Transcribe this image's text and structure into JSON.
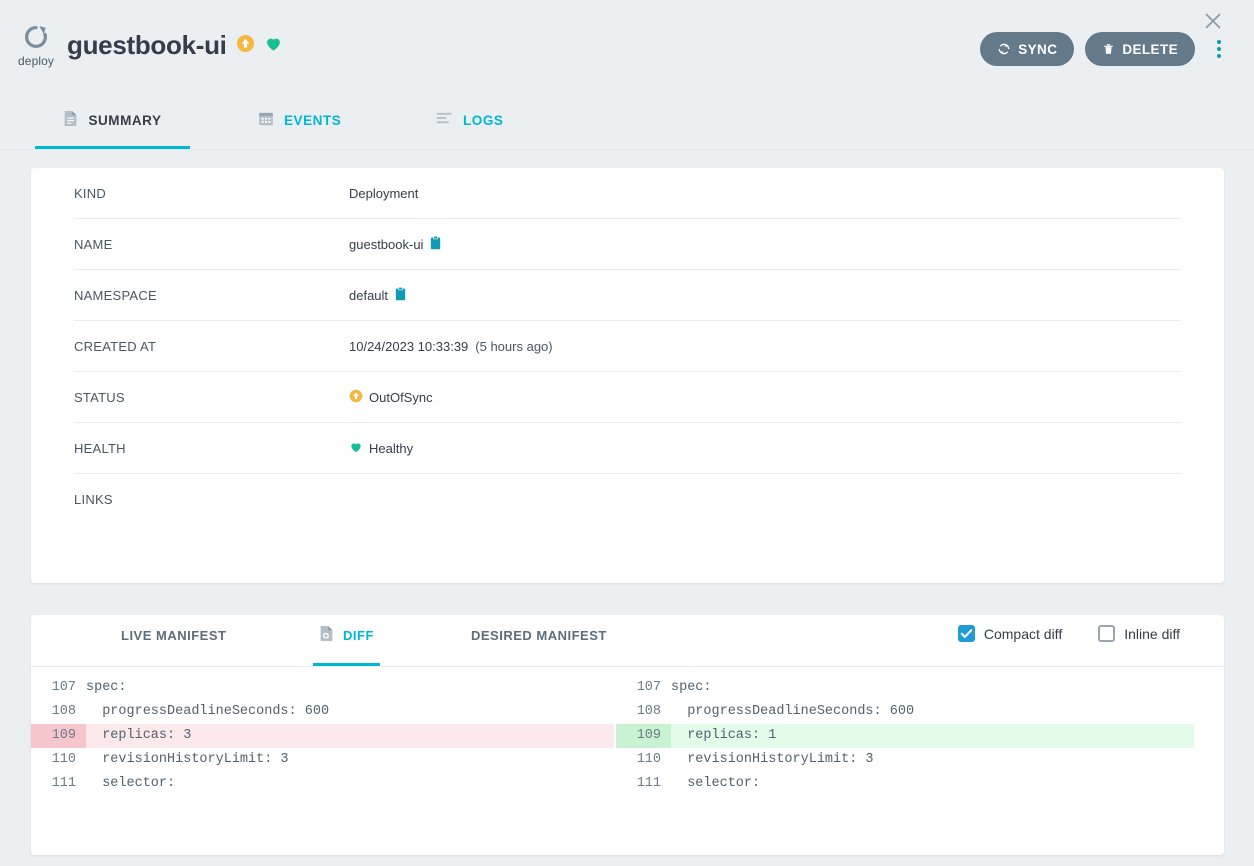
{
  "header": {
    "resource_icon_label": "deploy",
    "title": "guestbook-ui",
    "sync_badge": "out-of-sync",
    "health_badge": "healthy",
    "sync_button": "SYNC",
    "delete_button": "DELETE",
    "more_menu": "more-options",
    "close": "close"
  },
  "tabs": [
    {
      "label": "SUMMARY",
      "icon": "document-icon",
      "active": true
    },
    {
      "label": "EVENTS",
      "icon": "calendar-icon",
      "active": false
    },
    {
      "label": "LOGS",
      "icon": "logs-icon",
      "active": false
    }
  ],
  "summary": {
    "rows": [
      {
        "key": "KIND",
        "value": "Deployment",
        "copy": false,
        "icon": ""
      },
      {
        "key": "NAME",
        "value": "guestbook-ui",
        "copy": true,
        "icon": ""
      },
      {
        "key": "NAMESPACE",
        "value": "default",
        "copy": true,
        "icon": ""
      },
      {
        "key": "CREATED AT",
        "value": "10/24/2023 10:33:39",
        "extra": "(5 hours ago)",
        "copy": false,
        "icon": ""
      },
      {
        "key": "STATUS",
        "value": "OutOfSync",
        "copy": false,
        "icon": "out-of-sync-icon"
      },
      {
        "key": "HEALTH",
        "value": "Healthy",
        "copy": false,
        "icon": "heart-icon"
      },
      {
        "key": "LINKS",
        "value": "",
        "copy": false,
        "icon": ""
      }
    ]
  },
  "manifest": {
    "tabs": [
      {
        "label": "LIVE MANIFEST",
        "active": false,
        "icon": ""
      },
      {
        "label": "DIFF",
        "active": true,
        "icon": "diff-file-icon"
      },
      {
        "label": "DESIRED MANIFEST",
        "active": false,
        "icon": ""
      }
    ],
    "options": [
      {
        "label": "Compact diff",
        "checked": true
      },
      {
        "label": "Inline diff",
        "checked": false
      }
    ],
    "diff_lines": [
      {
        "changed": false,
        "left_no": "107",
        "left": "spec:",
        "right_no": "107",
        "right": "spec:"
      },
      {
        "changed": false,
        "left_no": "108",
        "left": "  progressDeadlineSeconds: 600",
        "right_no": "108",
        "right": "  progressDeadlineSeconds: 600"
      },
      {
        "changed": true,
        "left_no": "109",
        "left": "  replicas: 3",
        "right_no": "109",
        "right": "  replicas: 1"
      },
      {
        "changed": false,
        "left_no": "110",
        "left": "  revisionHistoryLimit: 3",
        "right_no": "110",
        "right": "  revisionHistoryLimit: 3"
      },
      {
        "changed": false,
        "left_no": "111",
        "left": "  selector:",
        "right_no": "111",
        "right": "  selector:"
      }
    ]
  },
  "colors": {
    "page_bg": "#ebeff2",
    "accent_cyan": "#00b7d4",
    "slate": "#64798a",
    "out_of_sync_orange": "#f4b740",
    "healthy_green": "#18be94",
    "teal": "#0f9bb5",
    "diff_del_gutter": "#f6c6cc",
    "diff_del_bg": "#fce9eb",
    "diff_add_gutter": "#c9f2d3",
    "diff_add_bg": "#e5fbea"
  }
}
